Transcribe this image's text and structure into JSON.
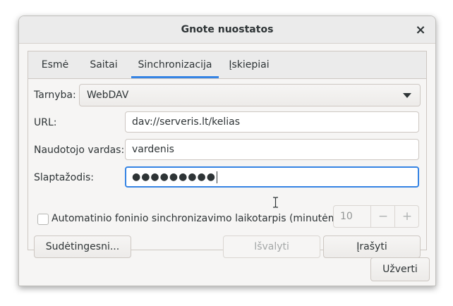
{
  "window": {
    "title": "Gnote nuostatos",
    "close_icon": "×"
  },
  "tabs": [
    {
      "label": "Esmė",
      "active": false
    },
    {
      "label": "Saitai",
      "active": false
    },
    {
      "label": "Sinchronizacija",
      "active": true
    },
    {
      "label": "Įskiepiai",
      "active": false
    }
  ],
  "sync": {
    "service_label": "Tarnyba:",
    "service_value": "WebDAV",
    "url_label": "URL:",
    "url_value": "dav://serveris.lt/kelias",
    "username_label": "Naudotojo vardas:",
    "username_value": "vardenis",
    "password_label": "Slaptažodis:",
    "password_value": "●●●●●●●●●",
    "autosync_label": "Automatinio foninio sinchronizavimo laikotarpis (minutėmis)",
    "autosync_checked": false,
    "interval_value": "10",
    "minus_icon": "−",
    "plus_icon": "+"
  },
  "buttons": {
    "advanced": "Sudėtingesni...",
    "clear": "Išvalyti",
    "save": "Įrašyti",
    "close": "Užverti"
  },
  "colors": {
    "accent": "#3584e4",
    "window_bg": "#f6f5f4",
    "text": "#2e3436"
  }
}
